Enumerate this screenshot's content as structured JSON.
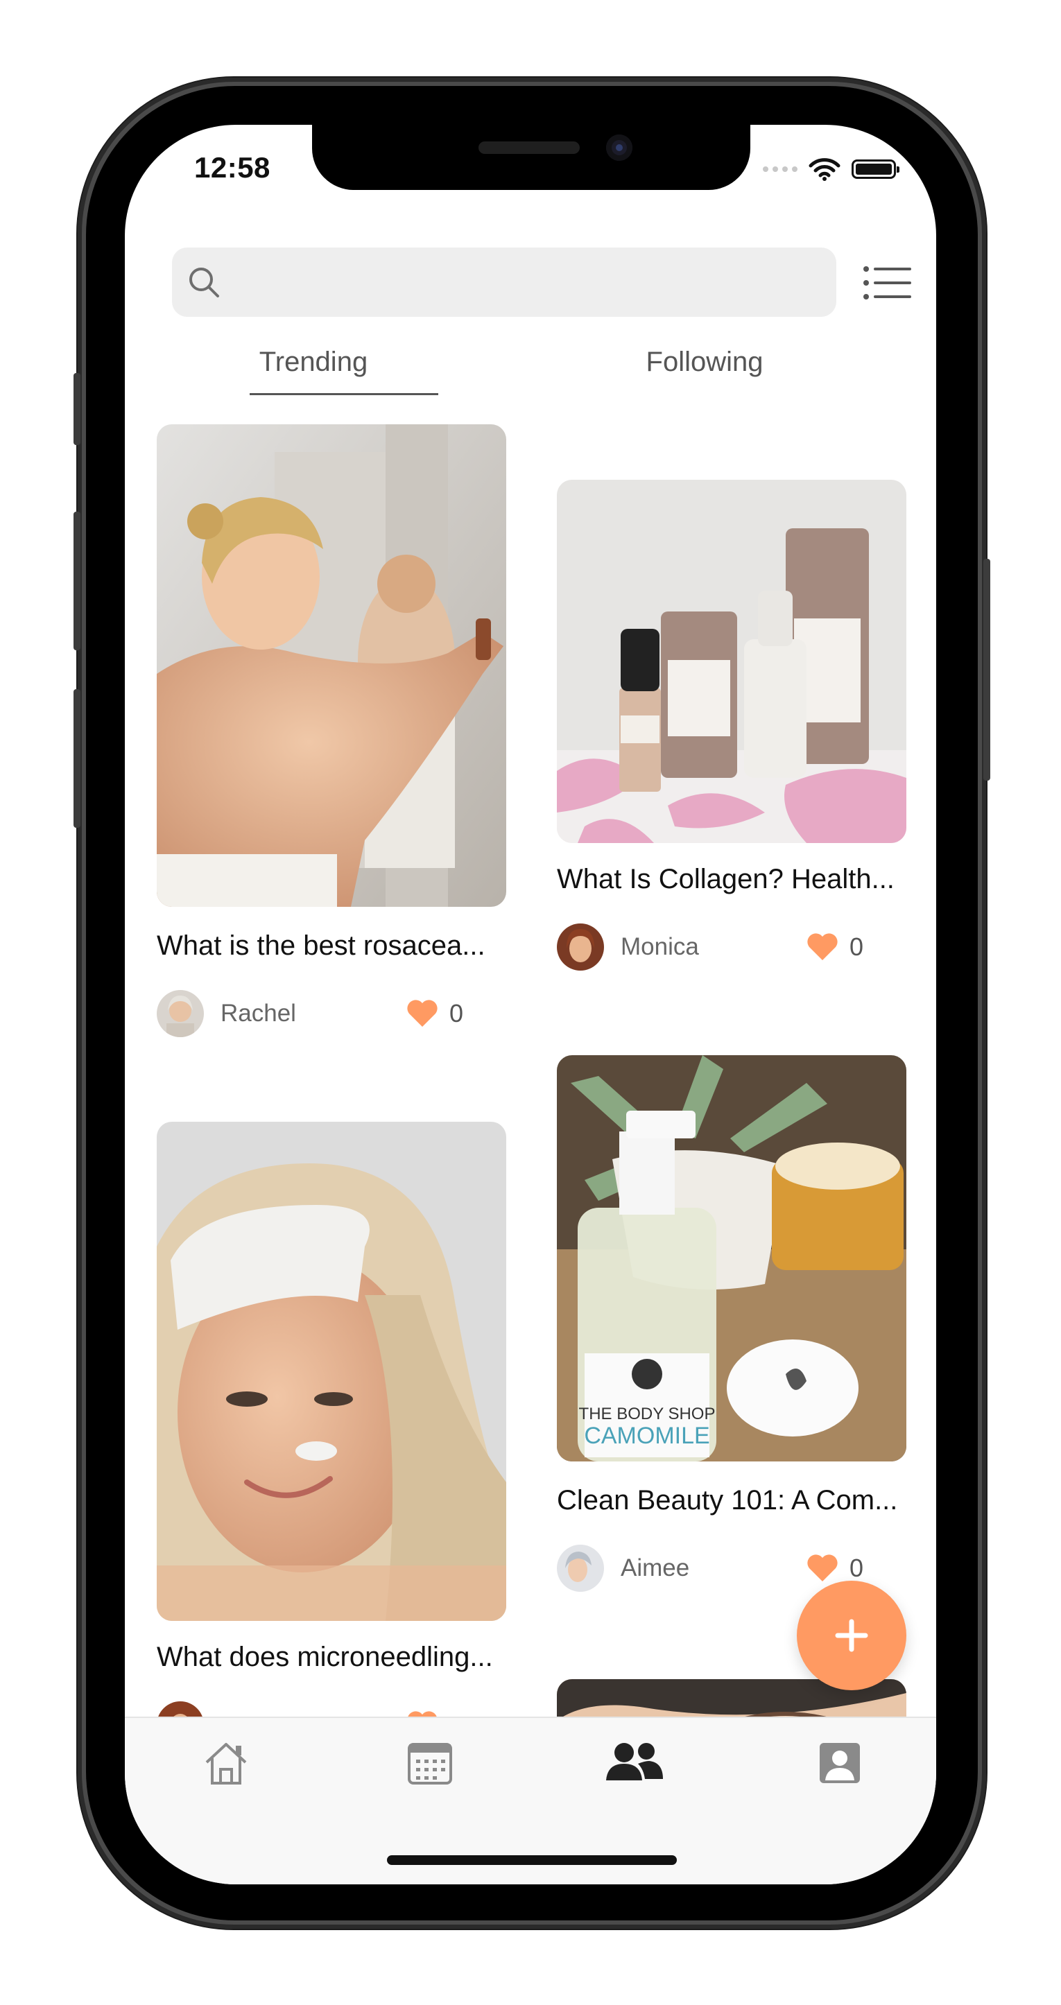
{
  "status_bar": {
    "time": "12:58"
  },
  "search": {
    "placeholder": ""
  },
  "tabs": [
    {
      "label": "Trending",
      "active": true
    },
    {
      "label": "Following",
      "active": false
    }
  ],
  "posts": [
    {
      "title": "What is the best rosacea...",
      "author": "Rachel",
      "likes": "0",
      "image": "woman-in-towel-mirror"
    },
    {
      "title": "What Is Collagen? Health...",
      "author": "Monica",
      "likes": "0",
      "image": "skincare-bottles-petals"
    },
    {
      "title": "What does microneedling...",
      "author": "",
      "likes": "",
      "image": "woman-headband-cream"
    },
    {
      "title": "Clean Beauty 101: A Com...",
      "author": "Aimee",
      "likes": "0",
      "image": "body-shop-camomile-bottle"
    }
  ],
  "colors": {
    "accent": "#ff9a62",
    "heart": "#ff9a62",
    "tab_active_icon": "#222222",
    "tab_inactive_icon": "#8a8a8a"
  },
  "bottom_nav": [
    {
      "name": "home-icon",
      "active": false
    },
    {
      "name": "calendar-icon",
      "active": false
    },
    {
      "name": "community-icon",
      "active": true
    },
    {
      "name": "profile-icon",
      "active": false
    }
  ],
  "fab": {
    "icon": "plus-icon"
  }
}
